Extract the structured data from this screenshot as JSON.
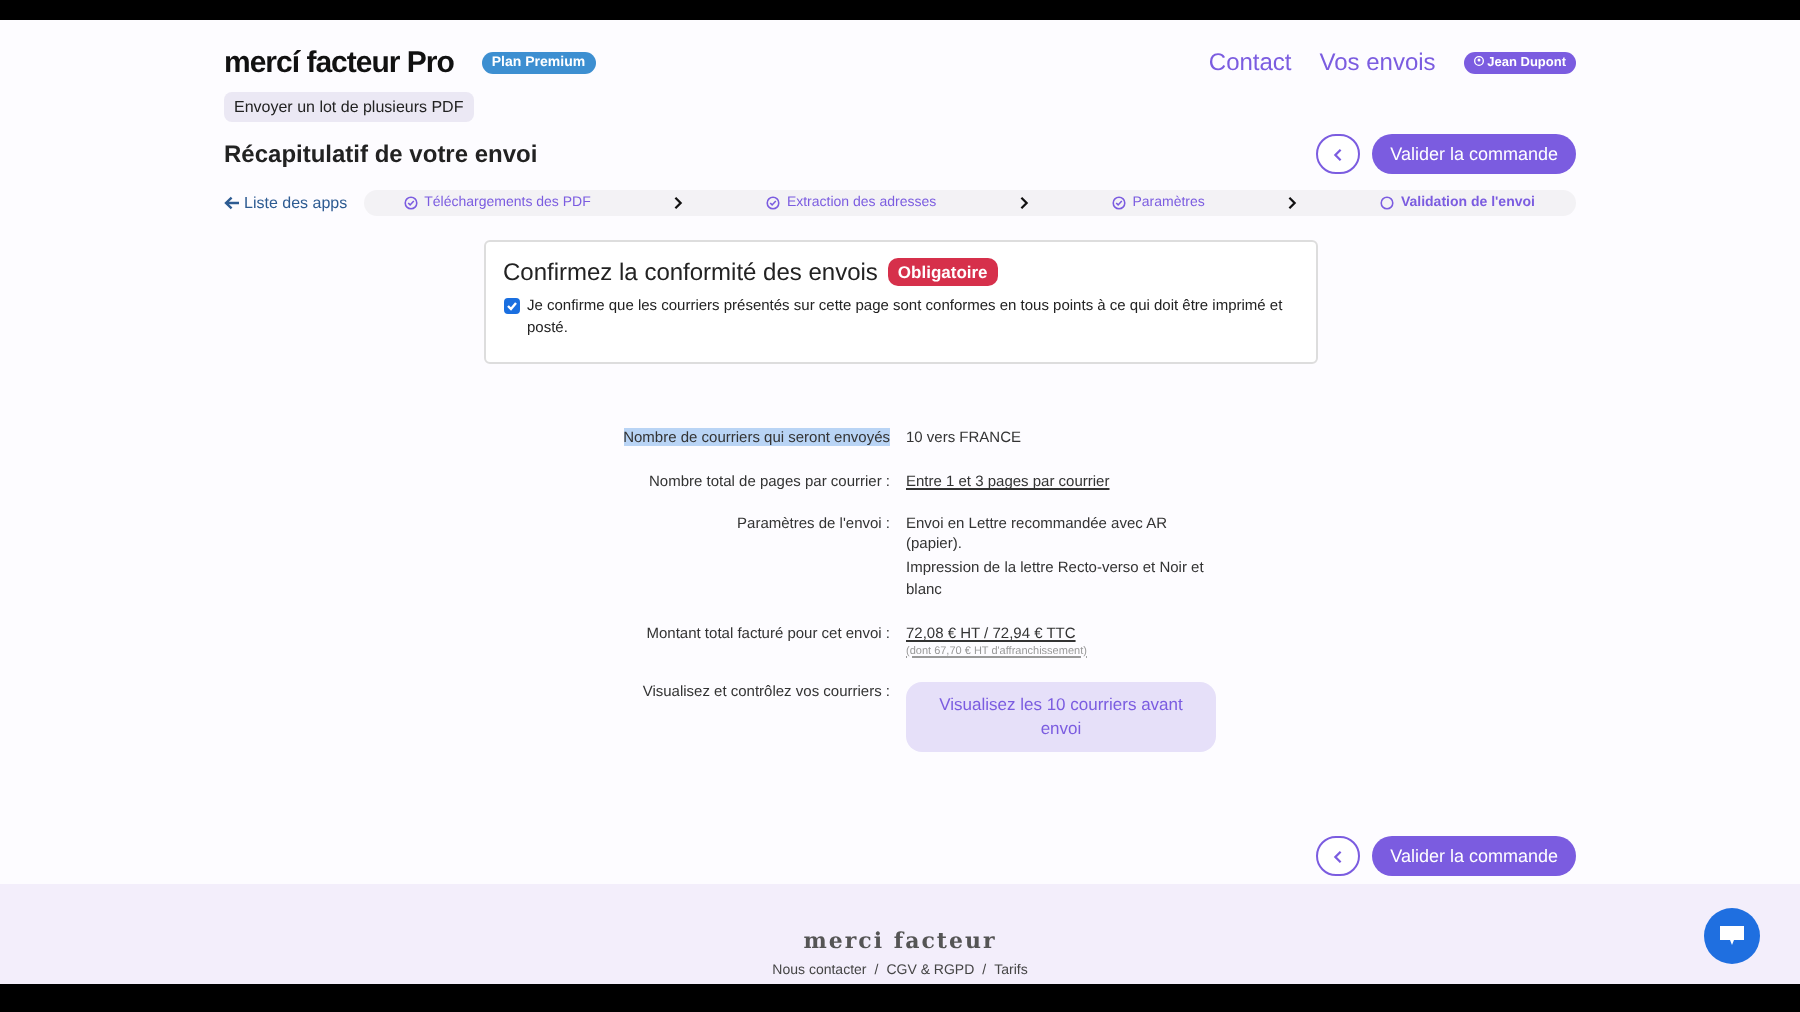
{
  "header": {
    "logo": "mercí facteur Pro",
    "plan_badge": "Plan Premium",
    "nav": [
      "Contact",
      "Vos envois"
    ],
    "user": "Jean Dupont"
  },
  "mode_tag": "Envoyer un lot de plusieurs PDF",
  "page_title": "Récapitulatif de votre envoi",
  "primary_action": "Valider la commande",
  "bottom_action": "Valider la commande",
  "back_link": "Liste des apps",
  "steps": [
    {
      "label": "Téléchargements des PDF",
      "done": true,
      "selected": false
    },
    {
      "label": "Extraction des adresses",
      "done": true,
      "selected": false
    },
    {
      "label": "Paramètres",
      "done": true,
      "selected": false
    },
    {
      "label": "Validation de l'envoi",
      "done": false,
      "selected": true
    }
  ],
  "confirm": {
    "title": "Confirmez la conformité des envois",
    "badge": "Obligatoire",
    "checked": true,
    "text": "Je confirme que les courriers présentés sur cette page sont conformes en tous points à ce qui doit être imprimé et posté."
  },
  "summary": [
    {
      "kind": "text",
      "label": "Nombre de courriers qui seront envoyés",
      "highlighted": true,
      "lines": [
        "10 vers FRANCE"
      ]
    },
    {
      "kind": "link",
      "label": "Nombre total de pages par courrier :",
      "highlighted": false,
      "lines": [
        "Entre 1 et 3 pages par courrier"
      ]
    },
    {
      "kind": "text",
      "label": "Paramètres de l'envoi :",
      "highlighted": false,
      "lines": [
        "Envoi en Lettre recommandée avec AR (papier).",
        "Impression de la lettre Recto-verso et Noir et blanc"
      ]
    },
    {
      "kind": "price",
      "label": "Montant total facturé pour cet envoi :",
      "highlighted": false,
      "lines": [
        "72,08 € HT / 72,94 € TTC",
        "(dont 67,70 € HT d'affranchissement)"
      ]
    },
    {
      "kind": "button",
      "label": "Visualisez et contrôlez vos courriers :",
      "highlighted": false,
      "lines": [
        "Visualisez les 10 courriers avant envoi"
      ]
    }
  ],
  "footer": {
    "brand": "merci facteur",
    "links": [
      "Nous contacter",
      "/",
      "CGV & RGPD",
      "/",
      "Tarifs"
    ]
  }
}
